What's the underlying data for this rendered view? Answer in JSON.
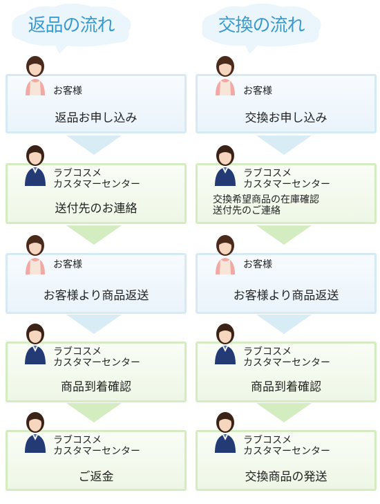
{
  "left": {
    "title": "返品の流れ",
    "steps": [
      {
        "actor": [
          "お客様"
        ],
        "action": "返品お申し込み"
      },
      {
        "actor": [
          "ラブコスメ",
          "カスタマーセンター"
        ],
        "action": "送付先のお連絡"
      },
      {
        "actor": [
          "お客様"
        ],
        "action": "お客様より商品返送"
      },
      {
        "actor": [
          "ラブコスメ",
          "カスタマーセンター"
        ],
        "action": "商品到着確認"
      },
      {
        "actor": [
          "ラブコスメ",
          "カスタマーセンター"
        ],
        "action": "ご返金"
      }
    ]
  },
  "right": {
    "title": "交換の流れ",
    "steps": [
      {
        "actor": [
          "お客様"
        ],
        "action": "交換お申し込み"
      },
      {
        "actor": [
          "ラブコスメ",
          "カスタマーセンター"
        ],
        "action_lines": [
          "交換希望商品の在庫確認",
          "送付先のご連絡"
        ]
      },
      {
        "actor": [
          "お客様"
        ],
        "action": "お客様より商品返送"
      },
      {
        "actor": [
          "ラブコスメ",
          "カスタマーセンター"
        ],
        "action": "商品到着確認"
      },
      {
        "actor": [
          "ラブコスメ",
          "カスタマーセンター"
        ],
        "action": "交換商品の発送"
      }
    ]
  },
  "colors": {
    "blue_border": "#d6eaf6",
    "green_border": "#d3ecc0",
    "title": "#3a9ad0"
  },
  "icons": {
    "customer": "customer-avatar-icon",
    "staff": "staff-avatar-icon"
  }
}
